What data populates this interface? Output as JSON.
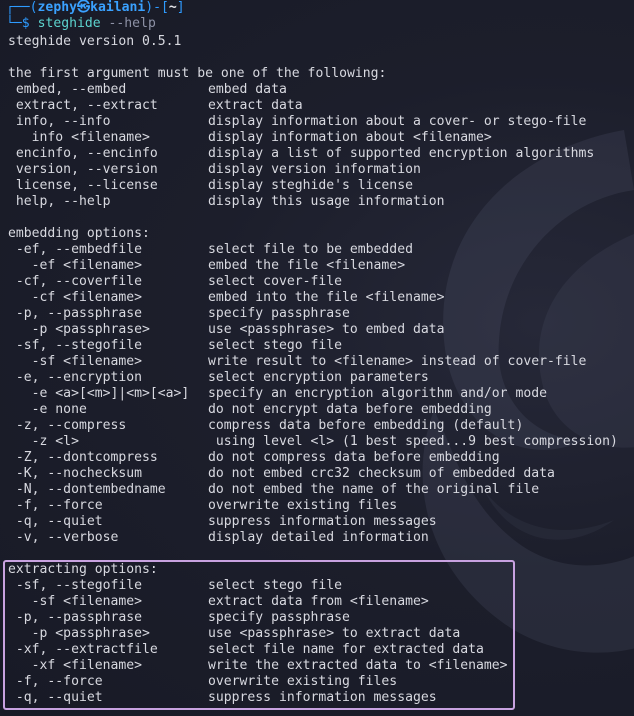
{
  "prompt": {
    "corner_top": "┌──(",
    "user": "zephy",
    "skull": "㉿",
    "host": "kailani",
    "close_paren": ")-[",
    "cwd": "~",
    "close_bracket": "]",
    "corner_bottom": "└─",
    "dollar": "$",
    "command": "steghide",
    "argument": "--help"
  },
  "output": [
    {
      "opt": "steghide version 0.5.1",
      "desc": ""
    },
    {
      "opt": "",
      "desc": ""
    },
    {
      "opt": "the first argument must be one of the following:",
      "desc": ""
    },
    {
      "opt": " embed, --embed",
      "desc": "embed data"
    },
    {
      "opt": " extract, --extract",
      "desc": "extract data"
    },
    {
      "opt": " info, --info",
      "desc": "display information about a cover- or stego-file"
    },
    {
      "opt": "   info <filename>",
      "desc": "display information about <filename>"
    },
    {
      "opt": " encinfo, --encinfo",
      "desc": "display a list of supported encryption algorithms"
    },
    {
      "opt": " version, --version",
      "desc": "display version information"
    },
    {
      "opt": " license, --license",
      "desc": "display steghide's license"
    },
    {
      "opt": " help, --help",
      "desc": "display this usage information"
    },
    {
      "opt": "",
      "desc": ""
    },
    {
      "opt": "embedding options:",
      "desc": ""
    },
    {
      "opt": " -ef, --embedfile",
      "desc": "select file to be embedded"
    },
    {
      "opt": "   -ef <filename>",
      "desc": "embed the file <filename>"
    },
    {
      "opt": " -cf, --coverfile",
      "desc": "select cover-file"
    },
    {
      "opt": "   -cf <filename>",
      "desc": "embed into the file <filename>"
    },
    {
      "opt": " -p, --passphrase",
      "desc": "specify passphrase"
    },
    {
      "opt": "   -p <passphrase>",
      "desc": "use <passphrase> to embed data"
    },
    {
      "opt": " -sf, --stegofile",
      "desc": "select stego file"
    },
    {
      "opt": "   -sf <filename>",
      "desc": "write result to <filename> instead of cover-file"
    },
    {
      "opt": " -e, --encryption",
      "desc": "select encryption parameters"
    },
    {
      "opt": "   -e <a>[<m>]|<m>[<a>]",
      "desc": "specify an encryption algorithm and/or mode"
    },
    {
      "opt": "   -e none",
      "desc": "do not encrypt data before embedding"
    },
    {
      "opt": " -z, --compress",
      "desc": "compress data before embedding (default)"
    },
    {
      "opt": "   -z <l>",
      "desc": " using level <l> (1 best speed...9 best compression)"
    },
    {
      "opt": " -Z, --dontcompress",
      "desc": "do not compress data before embedding"
    },
    {
      "opt": " -K, --nochecksum",
      "desc": "do not embed crc32 checksum of embedded data"
    },
    {
      "opt": " -N, --dontembedname",
      "desc": "do not embed the name of the original file"
    },
    {
      "opt": " -f, --force",
      "desc": "overwrite existing files"
    },
    {
      "opt": " -q, --quiet",
      "desc": "suppress information messages"
    },
    {
      "opt": " -v, --verbose",
      "desc": "display detailed information"
    },
    {
      "opt": "",
      "desc": ""
    },
    {
      "opt": "extracting options:",
      "desc": ""
    },
    {
      "opt": " -sf, --stegofile",
      "desc": "select stego file"
    },
    {
      "opt": "   -sf <filename>",
      "desc": "extract data from <filename>"
    },
    {
      "opt": " -p, --passphrase",
      "desc": "specify passphrase"
    },
    {
      "opt": "   -p <passphrase>",
      "desc": "use <passphrase> to extract data"
    },
    {
      "opt": " -xf, --extractfile",
      "desc": "select file name for extracted data"
    },
    {
      "opt": "   -xf <filename>",
      "desc": "write the extracted data to <filename>"
    },
    {
      "opt": " -f, --force",
      "desc": "overwrite existing files"
    },
    {
      "opt": " -q, --quiet",
      "desc": "suppress information messages"
    }
  ],
  "colors": {
    "background": "#1c1e2b",
    "prompt_frame": "#2e9bff",
    "command": "#5dd4cf",
    "argument": "#8e92a6",
    "highlight_border": "#c8a2e0"
  },
  "icons": {
    "watermark": "kali-dragon-icon"
  }
}
